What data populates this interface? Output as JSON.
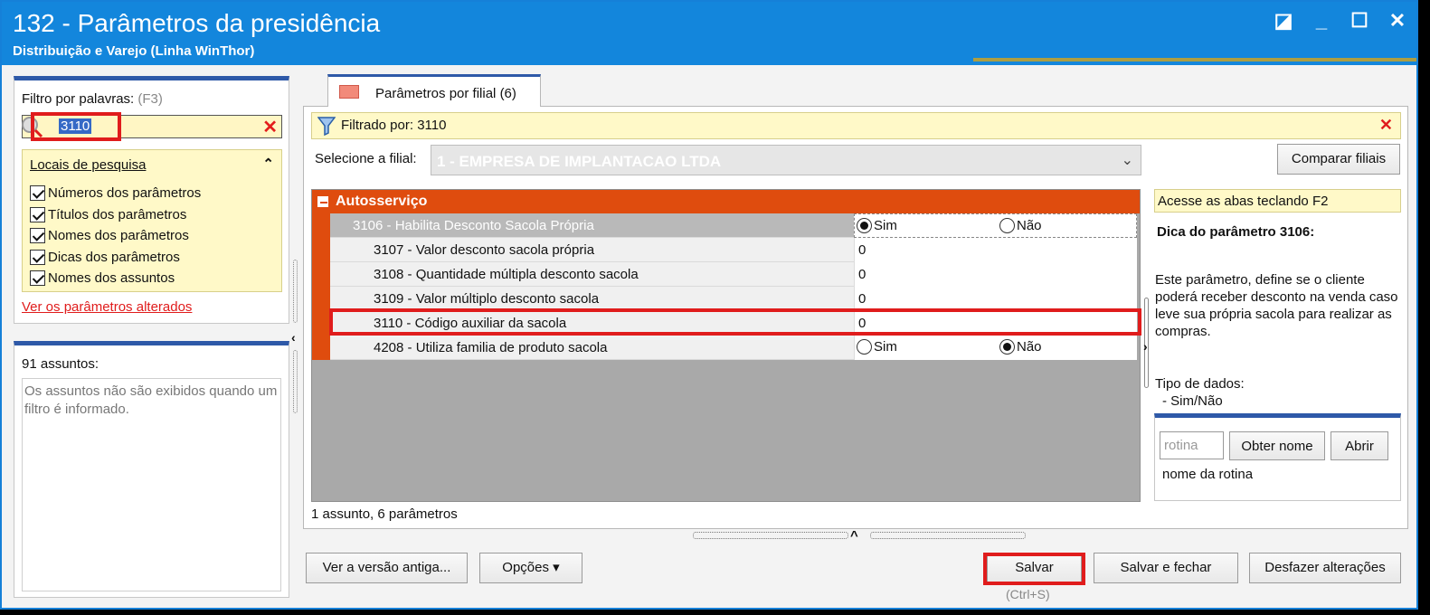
{
  "window": {
    "title": "132 - Parâmetros da presidência",
    "subtitle": "Distribuição e Varejo (Linha WinThor)",
    "controls": [
      "restore-icon",
      "minimize-icon",
      "maximize-icon",
      "close-icon"
    ]
  },
  "left": {
    "filter_label": "Filtro por palavras:",
    "filter_hint": "(F3)",
    "search_value": "3110",
    "locais_header": "Locais de pesquisa",
    "checkboxes": [
      "Números dos parâmetros",
      "Títulos dos parâmetros",
      "Nomes dos parâmetros",
      "Dicas dos parâmetros",
      "Nomes dos assuntos"
    ],
    "changed_link": "Ver os parâmetros alterados",
    "assuntos_title": "91 assuntos:",
    "assuntos_msg": "Os assuntos não são exibidos quando um filtro é informado."
  },
  "tab": {
    "label": "Parâmetros por filial",
    "count": "(6)"
  },
  "filter_bar": {
    "text": "Filtrado por: 3110"
  },
  "filial": {
    "label": "Selecione a filial:",
    "value": "1 - EMPRESA DE IMPLANTACAO LTDA",
    "compare_button": "Comparar filiais"
  },
  "grid": {
    "group": "Autosserviço",
    "rows": [
      {
        "name": "3106 - Habilita Desconto Sacola Própria",
        "type": "radio",
        "sim": "Sim",
        "nao": "Não",
        "selected": "Sim"
      },
      {
        "name": "3107 - Valor desconto sacola própria",
        "type": "value",
        "value": "0"
      },
      {
        "name": "3108 - Quantidade múltipla desconto sacola",
        "type": "value",
        "value": "0"
      },
      {
        "name": "3109 - Valor múltiplo desconto sacola",
        "type": "value",
        "value": "0"
      },
      {
        "name": "3110 - Código auxiliar da sacola",
        "type": "value",
        "value": "0"
      },
      {
        "name": "4208 - Utiliza familia de produto sacola",
        "type": "radio",
        "sim": "Sim",
        "nao": "Não",
        "selected": "Não"
      }
    ],
    "status": "1 assunto, 6 parâmetros"
  },
  "tip": {
    "key_hint": "Acesse as abas teclando F2",
    "title": "Dica do parâmetro 3106:",
    "text": "Este parâmetro, define se o cliente poderá receber desconto na venda caso leve sua própria sacola para realizar as compras.",
    "tipo_label": "Tipo de dados:",
    "tipo_value": "- Sim/Não",
    "rotina_placeholder": "rotina",
    "obter_button": "Obter nome",
    "abrir_button": "Abrir",
    "rotina_name": "nome da rotina"
  },
  "footer": {
    "old_version_button": "Ver a versão antiga...",
    "options_button": "Opções",
    "save_button": "Salvar",
    "save_shortcut": "(Ctrl+S)",
    "save_close_button": "Salvar e fechar",
    "undo_button": "Desfazer alterações"
  },
  "colors": {
    "accent": "#1386dc",
    "group": "#df4c0e",
    "highlight": "#e01c1c",
    "filter_bg": "#fff9c8"
  }
}
